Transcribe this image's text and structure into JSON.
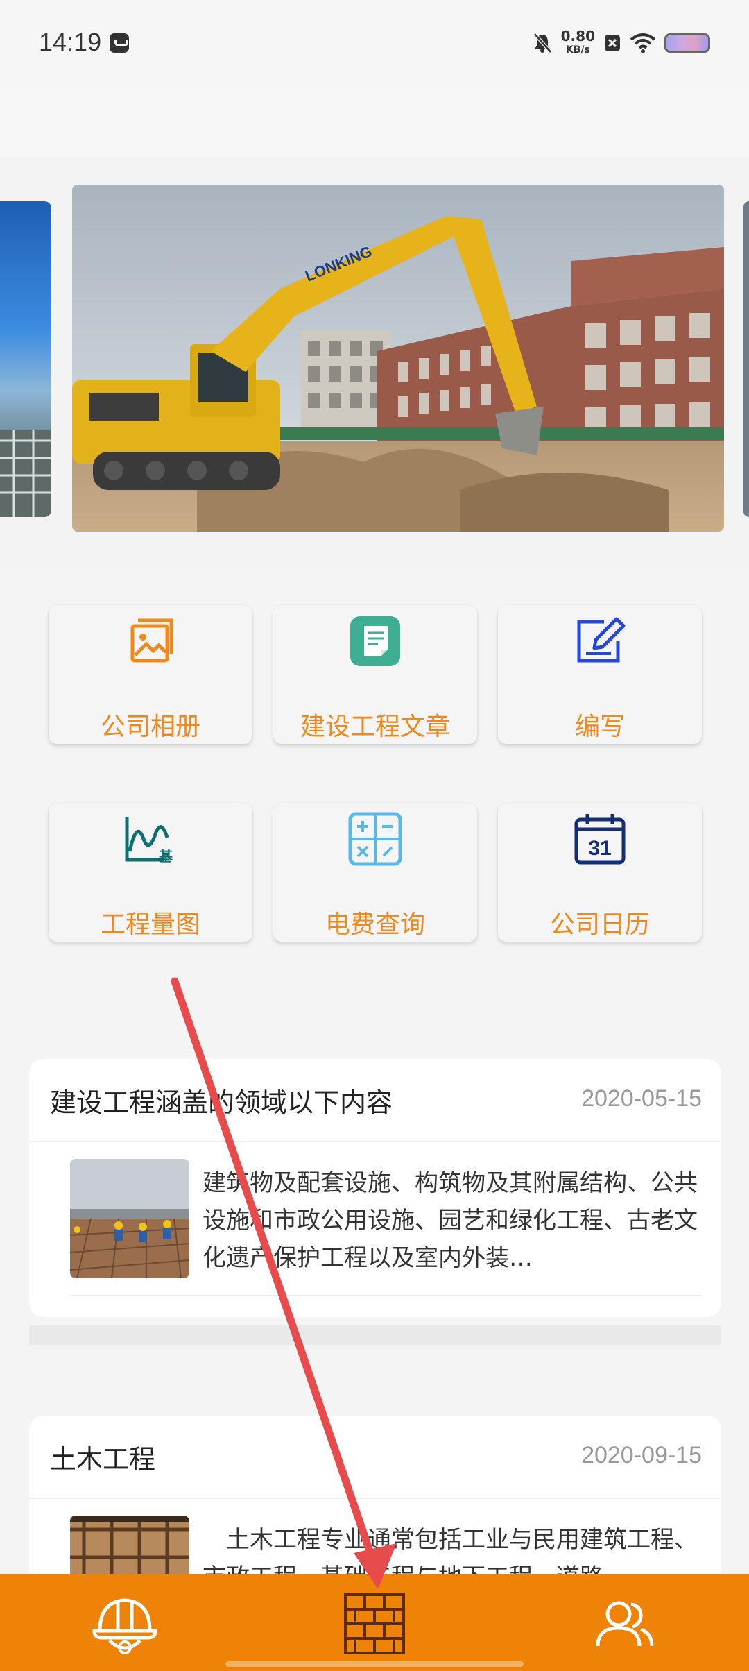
{
  "status": {
    "time": "14:19",
    "net_speed": "0.80",
    "net_unit": "KB/s"
  },
  "carousel": {
    "slide_text": "LONKING",
    "active_index": 1,
    "count": 3
  },
  "grid": {
    "items": [
      {
        "label": "公司相册",
        "icon": "photo-album-icon"
      },
      {
        "label": "建设工程文章",
        "icon": "document-icon"
      },
      {
        "label": "编写",
        "icon": "edit-icon"
      },
      {
        "label": "工程量图",
        "icon": "chart-icon"
      },
      {
        "label": "电费查询",
        "icon": "calculator-icon"
      },
      {
        "label": "公司日历",
        "icon": "calendar-icon"
      }
    ],
    "calendar_day": "31",
    "chart_char": "基"
  },
  "news": [
    {
      "title": "建设工程涵盖的领域以下内容",
      "date": "2020-05-15",
      "body": "建筑物及配套设施、构筑物及其附属结构、公共设施和市政公用设施、园艺和绿化工程、古老文化遗产保护工程以及室内外装…"
    },
    {
      "title": "土木工程",
      "date": "2020-09-15",
      "body": "　土木工程专业通常包括工业与民用建筑工程、市政工程、基础工程与地下工程、道路"
    }
  ],
  "nav": {
    "items": [
      {
        "icon": "helmet-icon"
      },
      {
        "icon": "brick-wall-icon"
      },
      {
        "icon": "users-icon"
      }
    ]
  },
  "colors": {
    "accent": "#ef8307",
    "label": "#ee8a1b",
    "annotation": "#e84b4b"
  }
}
